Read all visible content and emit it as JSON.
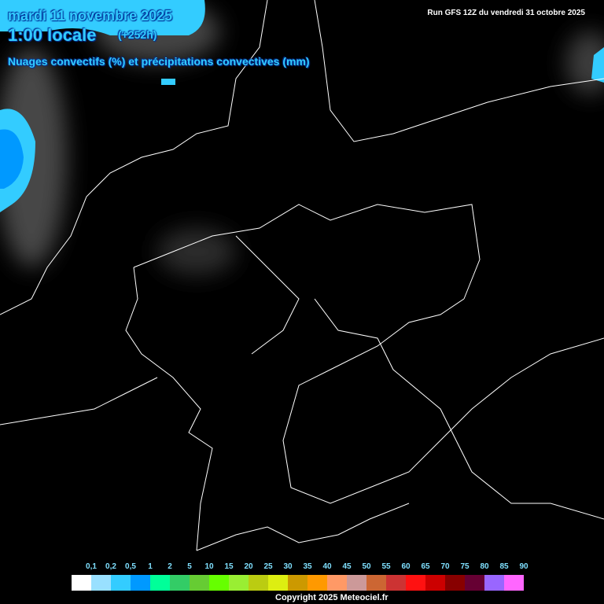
{
  "header": {
    "date": "mardi 11 novembre 2025",
    "hour": "1:00 locale",
    "lead": "(+252h)",
    "subtitle": "Nuages convectifs (%) et précipitations convectives (mm)",
    "run": "Run GFS 12Z du vendredi 31 octobre 2025"
  },
  "legend": {
    "labels": [
      "0,1",
      "0,2",
      "0,5",
      "1",
      "2",
      "5",
      "10",
      "15",
      "20",
      "25",
      "30",
      "35",
      "40",
      "45",
      "50",
      "55",
      "60",
      "65",
      "70",
      "75",
      "80",
      "85",
      "90"
    ],
    "colors": [
      "#ffffff",
      "#99e0ff",
      "#33ccff",
      "#0099ff",
      "#00ff99",
      "#33cc66",
      "#66cc33",
      "#66ff00",
      "#99ee33",
      "#bbcc11",
      "#ddee11",
      "#cc9900",
      "#ff9900",
      "#ff9966",
      "#cc9999",
      "#cc6633",
      "#cc3333",
      "#ff1111",
      "#cc0000",
      "#880000",
      "#660033",
      "#9966ff",
      "#ff66ff"
    ]
  },
  "footer": {
    "copyright": "Copyright 2025 Meteociel.fr"
  },
  "colors": {
    "title": "#33ccff",
    "background": "#000000",
    "borders": "#ffffff"
  }
}
